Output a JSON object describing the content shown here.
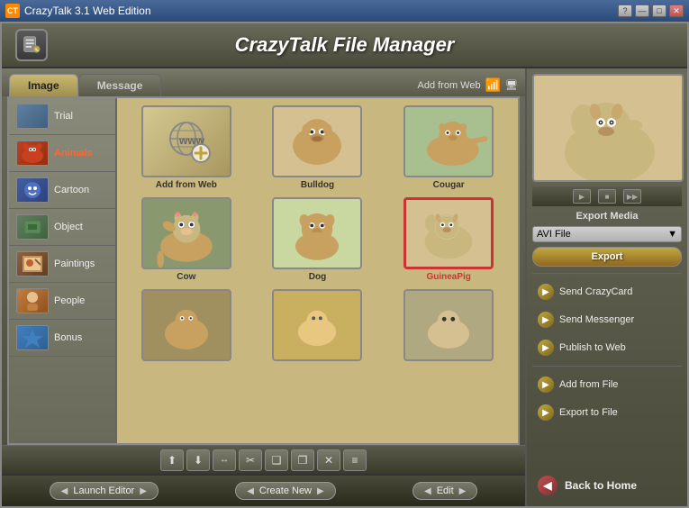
{
  "titleBar": {
    "title": "CrazyTalk 3.1 Web Edition",
    "helpBtn": "?",
    "minimizeBtn": "—",
    "maximizeBtn": "□",
    "closeBtn": "✕"
  },
  "header": {
    "title": "CrazyTalk File Manager"
  },
  "tabs": {
    "image": "Image",
    "message": "Message",
    "addFromWeb": "Add from Web"
  },
  "categories": [
    {
      "id": "trial",
      "label": "Trial",
      "active": false,
      "colorClass": "ct-trial"
    },
    {
      "id": "animals",
      "label": "Animals",
      "active": true,
      "colorClass": "ct-animals"
    },
    {
      "id": "cartoon",
      "label": "Cartoon",
      "active": false,
      "colorClass": "ct-cartoon"
    },
    {
      "id": "object",
      "label": "Object",
      "active": false,
      "colorClass": "ct-object"
    },
    {
      "id": "paintings",
      "label": "Paintings",
      "active": false,
      "colorClass": "ct-paintings"
    },
    {
      "id": "people",
      "label": "People",
      "active": false,
      "colorClass": "ct-people"
    },
    {
      "id": "bonus",
      "label": "Bonus",
      "active": false,
      "colorClass": "ct-bonus"
    }
  ],
  "images": [
    {
      "id": "add-web",
      "label": "Add from Web",
      "type": "add-web",
      "selected": false
    },
    {
      "id": "bulldog",
      "label": "Bulldog",
      "type": "dog",
      "selected": false
    },
    {
      "id": "cougar",
      "label": "Cougar",
      "type": "cougar",
      "selected": false
    },
    {
      "id": "cow",
      "label": "Cow",
      "type": "cow",
      "selected": false
    },
    {
      "id": "dog",
      "label": "Dog",
      "type": "dog2",
      "selected": false
    },
    {
      "id": "guineapig",
      "label": "GuineaPig",
      "type": "guinea",
      "selected": true
    },
    {
      "id": "img7",
      "label": "",
      "type": "animal7",
      "selected": false
    },
    {
      "id": "img8",
      "label": "",
      "type": "animal8",
      "selected": false
    },
    {
      "id": "img9",
      "label": "",
      "type": "animal9",
      "selected": false
    }
  ],
  "toolbar": {
    "btns": [
      "⬆",
      "⬇",
      "✂",
      "⬛",
      "❑",
      "❒",
      "✕",
      "≡"
    ]
  },
  "bottomButtons": {
    "launchEditor": "Launch Editor",
    "createNew": "Create New",
    "edit": "Edit"
  },
  "rightPanel": {
    "exportMedia": "Export Media",
    "aviFile": "AVI File",
    "exportBtn": "Export",
    "actions": [
      {
        "id": "send-crazycard",
        "label": "Send CrazyCard"
      },
      {
        "id": "send-messenger",
        "label": "Send Messenger"
      },
      {
        "id": "publish-web",
        "label": "Publish to Web"
      },
      {
        "id": "add-file",
        "label": "Add from File"
      },
      {
        "id": "export-file",
        "label": "Export to File"
      }
    ],
    "backToHome": "Back to Home"
  }
}
